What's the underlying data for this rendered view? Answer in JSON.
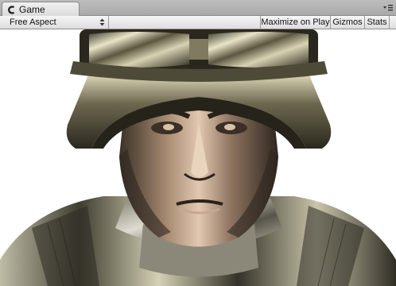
{
  "tab": {
    "label": "Game",
    "icon": "game-view-icon"
  },
  "window_menu": {
    "icon": "tab-menu-icon"
  },
  "toolbar": {
    "aspect": {
      "selected": "Free Aspect"
    },
    "maximize_on_play": "Maximize on Play",
    "gizmos": "Gizmos",
    "stats": "Stats"
  },
  "viewport": {
    "content": "rendered-scene",
    "background_color": "#ffffff"
  }
}
